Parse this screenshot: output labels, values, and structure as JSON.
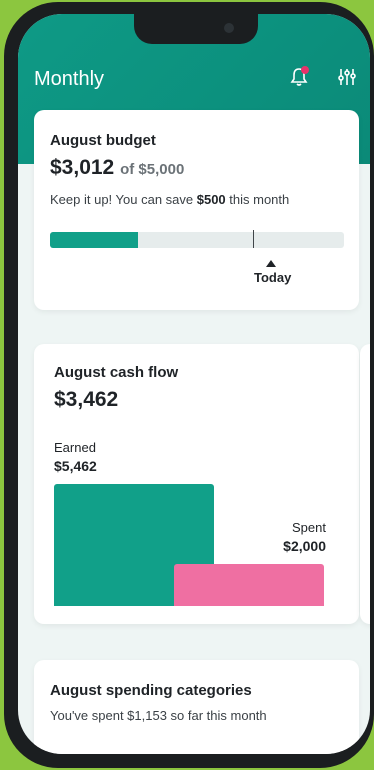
{
  "header": {
    "title": "Monthly",
    "notification_dot_color": "#e8326a",
    "bell_icon": "bell-icon",
    "filter_icon": "sliders-icon"
  },
  "budget": {
    "title": "August budget",
    "amount": "$3,012",
    "of_total": "of $5,000",
    "message_prefix": "Keep it up! You can save ",
    "message_amount": "$500",
    "message_suffix": " this month",
    "progress_fraction": 0.3,
    "today_marker_fraction": 0.74,
    "today_label": "Today"
  },
  "cash_flow": {
    "title": "August cash flow",
    "net": "$3,462",
    "earned_label": "Earned",
    "earned_value": "$5,462",
    "spent_label": "Spent",
    "spent_value": "$2,000"
  },
  "categories": {
    "title": "August spending categories",
    "subtitle": "You've spent $1,153 so far this month"
  }
}
